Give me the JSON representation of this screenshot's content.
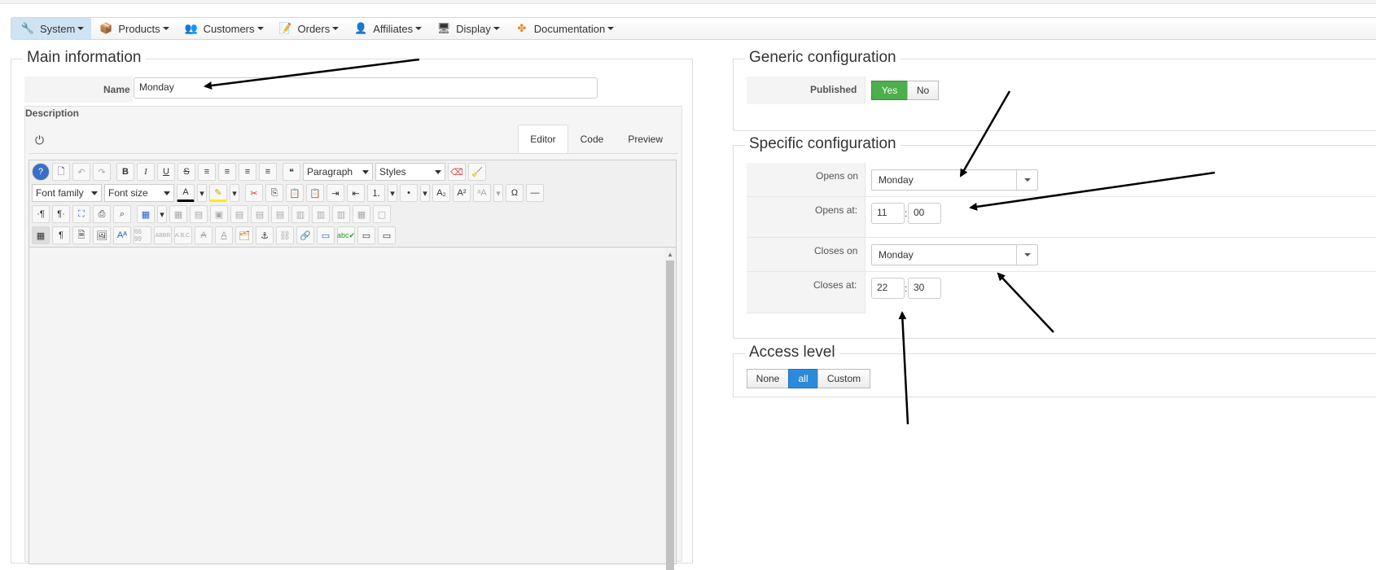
{
  "nav": [
    {
      "label": "System",
      "icon": "wrench-icon",
      "glyph": "🔧",
      "active": true
    },
    {
      "label": "Products",
      "icon": "box-icon",
      "glyph": "📦"
    },
    {
      "label": "Customers",
      "icon": "users-icon",
      "glyph": "👥"
    },
    {
      "label": "Orders",
      "icon": "orders-icon",
      "glyph": "📝"
    },
    {
      "label": "Affiliates",
      "icon": "affiliate-icon",
      "glyph": "👤"
    },
    {
      "label": "Display",
      "icon": "display-icon",
      "glyph": "🖥"
    },
    {
      "label": "Documentation",
      "icon": "lifebuoy-icon",
      "glyph": "✤"
    }
  ],
  "main": {
    "legend": "Main information",
    "name_label": "Name",
    "name_value": "Monday",
    "description_label": "Description",
    "tabs": [
      "Editor",
      "Code",
      "Preview"
    ],
    "power_glyph": "⏻",
    "toolbar": {
      "paragraph": "Paragraph",
      "styles": "Styles",
      "font_family": "Font family",
      "font_size": "Font size"
    }
  },
  "generic": {
    "legend": "Generic configuration",
    "published_label": "Published",
    "yes": "Yes",
    "no": "No"
  },
  "specific": {
    "legend": "Specific configuration",
    "opens_on_label": "Opens on",
    "opens_on_value": "Monday",
    "opens_at_label": "Opens at:",
    "opens_hour": "11",
    "opens_min": "00",
    "closes_on_label": "Closes on",
    "closes_on_value": "Monday",
    "closes_at_label": "Closes at:",
    "closes_hour": "22",
    "closes_min": "30",
    "time_sep": ":"
  },
  "access": {
    "legend": "Access level",
    "none": "None",
    "all": "all",
    "custom": "Custom"
  },
  "colors": {
    "accent_green": "#4cae4c",
    "accent_blue": "#2b8ad9",
    "nav_active": "#cfe3f2"
  }
}
